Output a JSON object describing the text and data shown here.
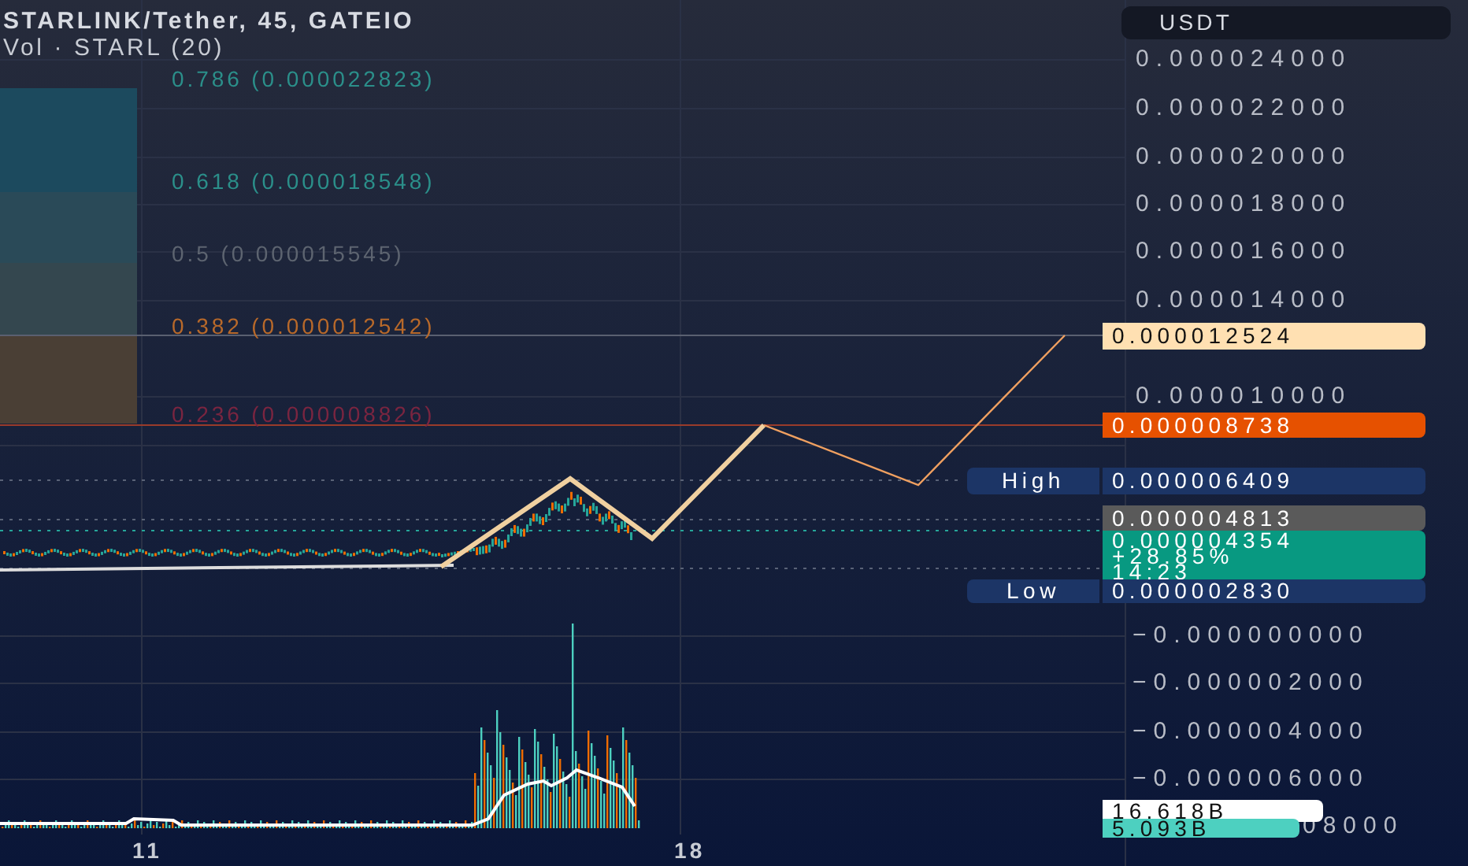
{
  "header": {
    "title": "STARLINK/Tether, 45, GATEIO",
    "indicator": "Vol · STARL (20)"
  },
  "fib_levels": [
    {
      "label": "0.786 (0.000022823)",
      "color": "#2b8f8a"
    },
    {
      "label": "0.618 (0.000018548)",
      "color": "#2b8f8a"
    },
    {
      "label": "0.5 (0.000015545)",
      "color": "#5d6470"
    },
    {
      "label": "0.382 (0.000012542)",
      "color": "#b8692a"
    },
    {
      "label": "0.236 (0.000008826)",
      "color": "#7a2540"
    }
  ],
  "axis": {
    "currency": "USDT",
    "ticks": [
      "0.000024000",
      "0.000022000",
      "0.000020000",
      "0.000018000",
      "0.000016000",
      "0.000014000",
      "0.000010000",
      "−0.000000000",
      "−0.000002000",
      "−0.000004000",
      "−0.000006000",
      "08000"
    ]
  },
  "price_marks": [
    {
      "kind": "target",
      "lines": [
        "0.000012524"
      ]
    },
    {
      "kind": "level",
      "lines": [
        "0.000008738"
      ]
    },
    {
      "kind": "high",
      "tag": "High",
      "lines": [
        "0.000006409"
      ]
    },
    {
      "kind": "previous",
      "lines": [
        "0.000004813"
      ]
    },
    {
      "kind": "last",
      "lines": [
        "0.000004354",
        "+28.85%",
        "14:23"
      ]
    },
    {
      "kind": "low",
      "tag": "Low",
      "lines": [
        "0.000002830"
      ]
    },
    {
      "kind": "volume",
      "lines": [
        "16.618B"
      ]
    },
    {
      "kind": "volume_ma",
      "lines": [
        "5.093B"
      ]
    }
  ],
  "time_axis": [
    "11",
    "18"
  ]
}
